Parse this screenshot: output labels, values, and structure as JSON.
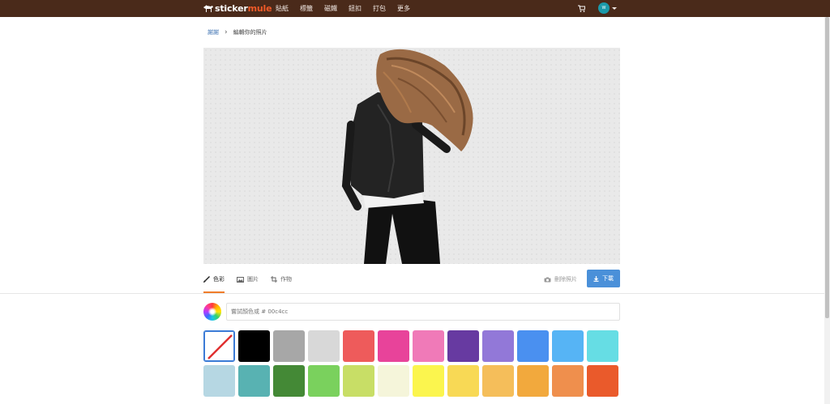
{
  "header": {
    "logo_part1": "sticker",
    "logo_part2": "mule",
    "nav": [
      "貼紙",
      "標籤",
      "磁鐵",
      "鈕扣",
      "打包",
      "更多"
    ],
    "avatar_initial": "W",
    "colors": {
      "bar": "#4a2a1a",
      "brand_orange": "#f05a28"
    }
  },
  "breadcrumb": {
    "link": "謝謝",
    "current": "編輯你的照片"
  },
  "tabs": [
    {
      "label": "色彩",
      "icon": "brush-icon",
      "active": true
    },
    {
      "label": "圖片",
      "icon": "image-icon",
      "active": false
    },
    {
      "label": "作物",
      "icon": "crop-icon",
      "active": false
    }
  ],
  "actions": {
    "remove_bg_label": "刪除照片",
    "download_label": "下載"
  },
  "color_picker": {
    "placeholder": "嘗試顏色或 # 00c4cc"
  },
  "swatches": [
    "none",
    "#000000",
    "#a7a7a7",
    "#d8d8d8",
    "#ee5b5b",
    "#e8439a",
    "#f07ab8",
    "#673aa1",
    "#9278d8",
    "#4a90f0",
    "#56b4f5",
    "#66dde4",
    "#b6d7e3",
    "#58b2b2",
    "#448936",
    "#7ad15d",
    "#c8de66",
    "#f5f5da",
    "#fbf54e",
    "#f8d955",
    "#f5be5a",
    "#f2a93d",
    "#ef8f4d",
    "#ea5a2b"
  ]
}
